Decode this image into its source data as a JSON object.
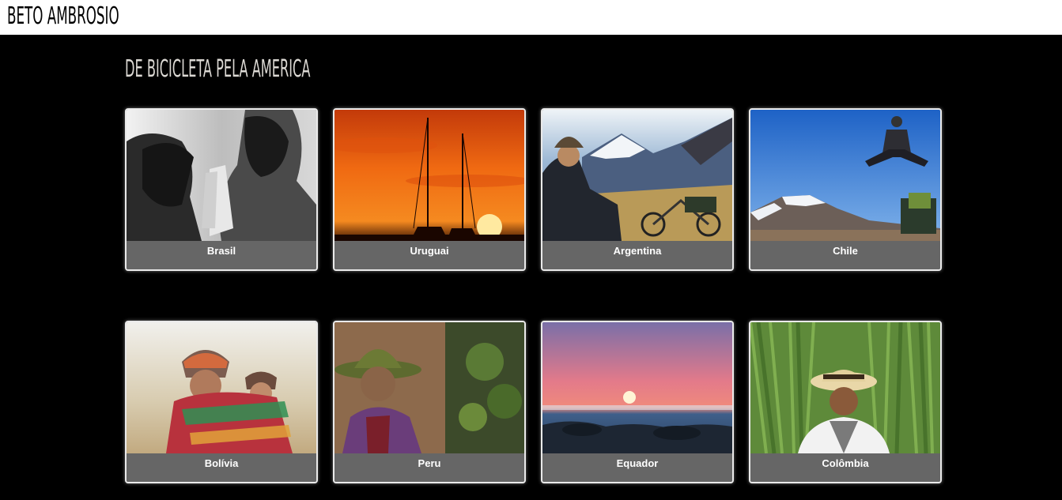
{
  "header": {
    "site_title": "BETO AMBROSIO"
  },
  "main": {
    "title": "DE BICICLETA PELA AMERICA",
    "countries": [
      {
        "label": "Brasil"
      },
      {
        "label": "Uruguai"
      },
      {
        "label": "Argentina"
      },
      {
        "label": "Chile"
      },
      {
        "label": "Bolívia"
      },
      {
        "label": "Peru"
      },
      {
        "label": "Equador"
      },
      {
        "label": "Colômbia"
      }
    ]
  },
  "colors": {
    "background": "#000000",
    "header_bg": "#ffffff",
    "card_label_bg": "#666666",
    "title_text": "#dcd9d4"
  }
}
